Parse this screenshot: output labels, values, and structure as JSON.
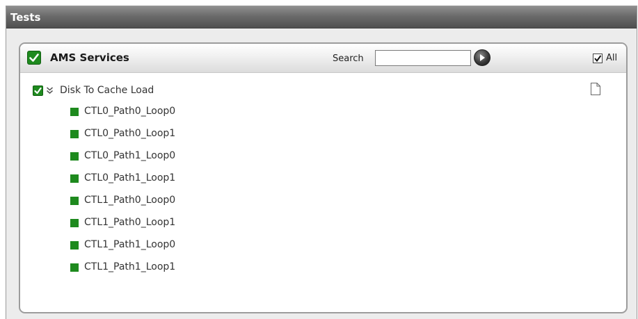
{
  "window": {
    "title": "Tests"
  },
  "panel": {
    "title": "AMS Services",
    "search_label": "Search",
    "search_value": "",
    "search_placeholder": "",
    "all_label": "All",
    "all_checked": true
  },
  "tree": {
    "root_label": "Disk To Cache Load",
    "root_checked": true,
    "children": [
      {
        "label": "CTL0_Path0_Loop0"
      },
      {
        "label": "CTL0_Path0_Loop1"
      },
      {
        "label": "CTL0_Path1_Loop0"
      },
      {
        "label": "CTL0_Path1_Loop1"
      },
      {
        "label": "CTL1_Path0_Loop0"
      },
      {
        "label": "CTL1_Path0_Loop1"
      },
      {
        "label": "CTL1_Path1_Loop0"
      },
      {
        "label": "CTL1_Path1_Loop1"
      }
    ]
  },
  "icons": {
    "section_check": "check-icon",
    "root_check": "check-icon",
    "collapse": "chevron-double-down-icon",
    "go": "arrow-right-circle-icon",
    "document": "document-icon",
    "child_status": "green-square-icon"
  },
  "colors": {
    "accent_green": "#1f8a1f",
    "header_dark": "#4f4f4f"
  }
}
